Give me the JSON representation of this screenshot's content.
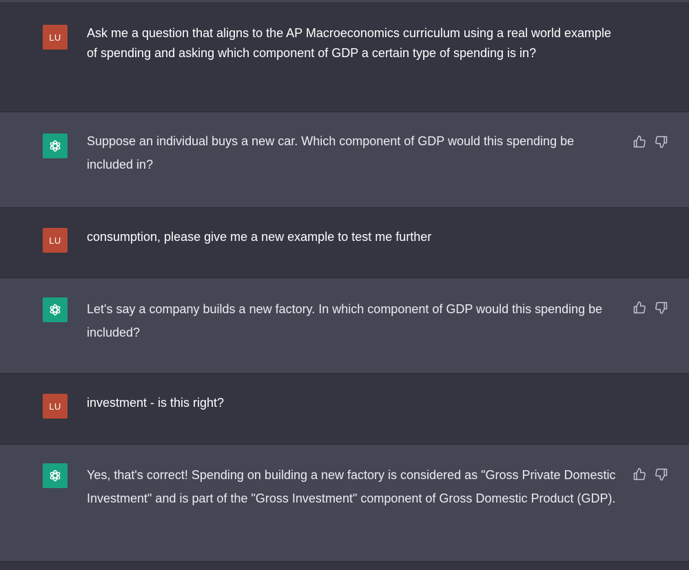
{
  "colors": {
    "user_bg": "#343541",
    "bot_bg": "#444654",
    "user_avatar": "#b84a35",
    "bot_avatar": "#19a27f",
    "text": "#ececf1"
  },
  "conversation": [
    {
      "role": "user",
      "avatar_label": "LU",
      "text": "Ask me a question that aligns to the AP Macroeconomics curriculum using a real world example of spending and asking which component of GDP a certain type of spending is in?"
    },
    {
      "role": "assistant",
      "avatar_icon": "openai-logo-icon",
      "text": "Suppose an individual buys a new car. Which component of GDP would this spending be included in?",
      "feedback_icons": [
        "thumbs-up-icon",
        "thumbs-down-icon"
      ]
    },
    {
      "role": "user",
      "avatar_label": "LU",
      "text": "consumption, please give me a new example to test me further"
    },
    {
      "role": "assistant",
      "avatar_icon": "openai-logo-icon",
      "text": "Let's say a company builds a new factory. In which component of GDP would this spending be included?",
      "feedback_icons": [
        "thumbs-up-icon",
        "thumbs-down-icon"
      ]
    },
    {
      "role": "user",
      "avatar_label": "LU",
      "text": "investment - is this right?"
    },
    {
      "role": "assistant",
      "avatar_icon": "openai-logo-icon",
      "text": "Yes, that's correct! Spending on building a new factory is considered as \"Gross Private Domestic Investment\" and is part of the \"Gross Investment\" component of Gross Domestic Product (GDP).",
      "feedback_icons": [
        "thumbs-up-icon",
        "thumbs-down-icon"
      ]
    }
  ]
}
